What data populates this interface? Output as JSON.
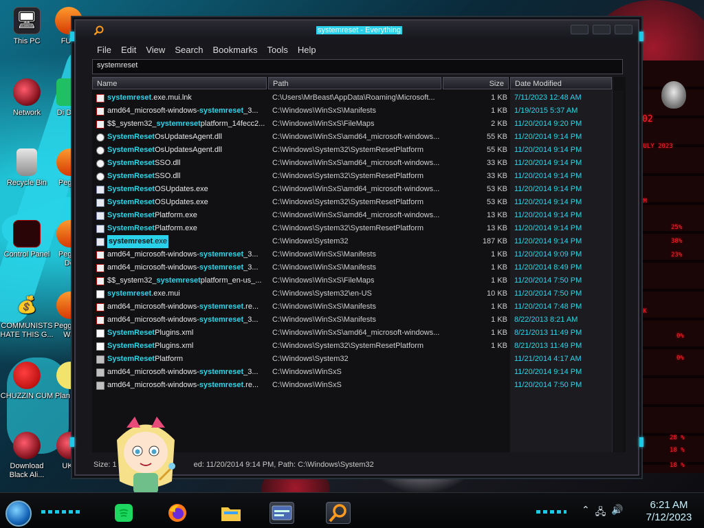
{
  "window": {
    "title": "systemreset - Everything",
    "menu": [
      "File",
      "Edit",
      "View",
      "Search",
      "Bookmarks",
      "Tools",
      "Help"
    ],
    "search_value": "systemreset",
    "columns": {
      "name": "Name",
      "path": "Path",
      "size": "Size",
      "date": "Date Modified"
    },
    "rows": [
      {
        "pre": "",
        "hl": "systemreset",
        "post": ".exe.mui.lnk",
        "path": "C:\\Users\\MrBeast\\AppData\\Roaming\\Microsoft...",
        "size": "1 KB",
        "date": "7/11/2023 12:48 AM",
        "icon": "lnk"
      },
      {
        "pre": "amd64_microsoft-windows-",
        "hl": "systemreset",
        "post": "_3...",
        "path": "C:\\Windows\\WinSxS\\Manifests",
        "size": "1 KB",
        "date": "1/19/2015 5:37 AM",
        "icon": "manifest"
      },
      {
        "pre": "$$_system32_",
        "hl": "systemreset",
        "post": "platform_14fecc2...",
        "path": "C:\\Windows\\WinSxS\\FileMaps",
        "size": "2 KB",
        "date": "11/20/2014 9:20 PM",
        "icon": "manifest"
      },
      {
        "pre": "",
        "hl": "SystemReset",
        "post": "OsUpdatesAgent.dll",
        "path": "C:\\Windows\\WinSxS\\amd64_microsoft-windows...",
        "size": "55 KB",
        "date": "11/20/2014 9:14 PM",
        "icon": "dll"
      },
      {
        "pre": "",
        "hl": "SystemReset",
        "post": "OsUpdatesAgent.dll",
        "path": "C:\\Windows\\System32\\SystemResetPlatform",
        "size": "55 KB",
        "date": "11/20/2014 9:14 PM",
        "icon": "dll"
      },
      {
        "pre": "",
        "hl": "SystemReset",
        "post": "SSO.dll",
        "path": "C:\\Windows\\WinSxS\\amd64_microsoft-windows...",
        "size": "33 KB",
        "date": "11/20/2014 9:14 PM",
        "icon": "dll"
      },
      {
        "pre": "",
        "hl": "SystemReset",
        "post": "SSO.dll",
        "path": "C:\\Windows\\System32\\SystemResetPlatform",
        "size": "33 KB",
        "date": "11/20/2014 9:14 PM",
        "icon": "dll"
      },
      {
        "pre": "",
        "hl": "SystemReset",
        "post": "OSUpdates.exe",
        "path": "C:\\Windows\\WinSxS\\amd64_microsoft-windows...",
        "size": "53 KB",
        "date": "11/20/2014 9:14 PM",
        "icon": "exe"
      },
      {
        "pre": "",
        "hl": "SystemReset",
        "post": "OSUpdates.exe",
        "path": "C:\\Windows\\System32\\SystemResetPlatform",
        "size": "53 KB",
        "date": "11/20/2014 9:14 PM",
        "icon": "exe"
      },
      {
        "pre": "",
        "hl": "SystemReset",
        "post": "Platform.exe",
        "path": "C:\\Windows\\WinSxS\\amd64_microsoft-windows...",
        "size": "13 KB",
        "date": "11/20/2014 9:14 PM",
        "icon": "exe"
      },
      {
        "pre": "",
        "hl": "SystemReset",
        "post": "Platform.exe",
        "path": "C:\\Windows\\System32\\SystemResetPlatform",
        "size": "13 KB",
        "date": "11/20/2014 9:14 PM",
        "icon": "exe"
      },
      {
        "pre": "",
        "hl": "systemreset",
        "post": ".exe",
        "path": "C:\\Windows\\System32",
        "size": "187 KB",
        "date": "11/20/2014 9:14 PM",
        "icon": "exe",
        "selected": true
      },
      {
        "pre": "amd64_microsoft-windows-",
        "hl": "systemreset",
        "post": "_3...",
        "path": "C:\\Windows\\WinSxS\\Manifests",
        "size": "1 KB",
        "date": "11/20/2014 9:09 PM",
        "icon": "manifest"
      },
      {
        "pre": "amd64_microsoft-windows-",
        "hl": "systemreset",
        "post": "_3...",
        "path": "C:\\Windows\\WinSxS\\Manifests",
        "size": "1 KB",
        "date": "11/20/2014 8:49 PM",
        "icon": "manifest"
      },
      {
        "pre": "$$_system32_",
        "hl": "systemreset",
        "post": "platform_en-us_...",
        "path": "C:\\Windows\\WinSxS\\FileMaps",
        "size": "1 KB",
        "date": "11/20/2014 7:50 PM",
        "icon": "manifest"
      },
      {
        "pre": "",
        "hl": "systemreset",
        "post": ".exe.mui",
        "path": "C:\\Windows\\System32\\en-US",
        "size": "10 KB",
        "date": "11/20/2014 7:50 PM",
        "icon": "xml"
      },
      {
        "pre": "amd64_microsoft-windows-",
        "hl": "systemreset",
        "post": ".re...",
        "path": "C:\\Windows\\WinSxS\\Manifests",
        "size": "1 KB",
        "date": "11/20/2014 7:48 PM",
        "icon": "manifest"
      },
      {
        "pre": "amd64_microsoft-windows-",
        "hl": "systemreset",
        "post": "_3...",
        "path": "C:\\Windows\\WinSxS\\Manifests",
        "size": "1 KB",
        "date": "8/22/2013 8:21 AM",
        "icon": "manifest"
      },
      {
        "pre": "",
        "hl": "SystemReset",
        "post": "Plugins.xml",
        "path": "C:\\Windows\\WinSxS\\amd64_microsoft-windows...",
        "size": "1 KB",
        "date": "8/21/2013 11:49 PM",
        "icon": "xml"
      },
      {
        "pre": "",
        "hl": "SystemReset",
        "post": "Plugins.xml",
        "path": "C:\\Windows\\System32\\SystemResetPlatform",
        "size": "1 KB",
        "date": "8/21/2013 11:49 PM",
        "icon": "xml"
      },
      {
        "pre": "",
        "hl": "SystemReset",
        "post": "Platform",
        "path": "C:\\Windows\\System32",
        "size": "",
        "date": "11/21/2014 4:17 AM",
        "icon": "folder"
      },
      {
        "pre": "amd64_microsoft-windows-",
        "hl": "systemreset",
        "post": "_3...",
        "path": "C:\\Windows\\WinSxS",
        "size": "",
        "date": "11/20/2014 9:14 PM",
        "icon": "folder"
      },
      {
        "pre": "amd64_microsoft-windows-",
        "hl": "systemreset",
        "post": ".re...",
        "path": "C:\\Windows\\WinSxS",
        "size": "",
        "date": "11/20/2014 7:50 PM",
        "icon": "folder"
      }
    ],
    "status": {
      "prefix": "Size: 1",
      "suffix": "ed: 11/20/2014 9:14 PM, Path: C:\\Windows\\System32"
    }
  },
  "desktop_icons": [
    {
      "label": "This PC"
    },
    {
      "label": "Network"
    },
    {
      "label": "Recycle Bin"
    },
    {
      "label": "Control Panel"
    },
    {
      "label": "COMMUNISTS HATE THIS G..."
    },
    {
      "label": "CHUZZIN CUM"
    },
    {
      "label": "Download Black Ali..."
    },
    {
      "label": "FUR"
    },
    {
      "label": "Di DUM"
    },
    {
      "label": "Peggle"
    },
    {
      "label": "Peggle Del"
    },
    {
      "label": "Peggle of War"
    },
    {
      "label": "Plan Zon"
    },
    {
      "label": "UKR"
    }
  ],
  "gadget": {
    "texts": [
      "02",
      "JULY 2023",
      "EM",
      "25%",
      "38%",
      "23%",
      "RK",
      "0%",
      "0%",
      "28 %",
      "18 %",
      "18 %"
    ]
  },
  "taskbar": {
    "apps": [
      "spotify",
      "firefox",
      "file-explorer",
      "control",
      "everything"
    ],
    "time": "6:21 AM",
    "date": "7/12/2023"
  },
  "colors": {
    "accent": "#2ad1e8",
    "highlight_text": "#2fd6ea",
    "window_bg": "#18181c",
    "gadget_red": "#ff2233"
  }
}
